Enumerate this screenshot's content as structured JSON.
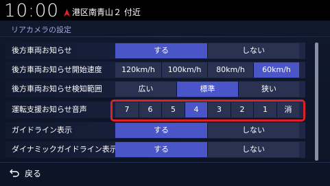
{
  "status": {
    "time": "10:00",
    "location": "港区南青山２ 付近"
  },
  "screen": {
    "title": "リアカメラの設定"
  },
  "settings": [
    {
      "label": "後方車両お知らせ",
      "options": [
        "する",
        "しない"
      ],
      "selected": 0
    },
    {
      "label": "後方車両お知らせ開始速度",
      "options": [
        "120km/h",
        "100km/h",
        "80km/h",
        "60km/h"
      ],
      "selected": 3
    },
    {
      "label": "後方車両お知らせ検知範囲",
      "options": [
        "広い",
        "標準",
        "狭い"
      ],
      "selected": 1
    },
    {
      "label": "運転支援お知らせ音声",
      "options": [
        "7",
        "6",
        "5",
        "4",
        "3",
        "2",
        "1",
        "消"
      ],
      "selected": 3
    },
    {
      "label": "ガイドライン表示",
      "options": [
        "する",
        "しない"
      ],
      "selected": 0
    },
    {
      "label": "ダイナミックガイドライン表示",
      "options": [
        "する",
        "しない"
      ],
      "selected": 0
    }
  ],
  "footer": {
    "back_label": "戻る"
  },
  "colors": {
    "selected": "#4a55c8",
    "unselected": "#2a3251",
    "highlight": "#e02028",
    "title": "#9fa8d8"
  }
}
